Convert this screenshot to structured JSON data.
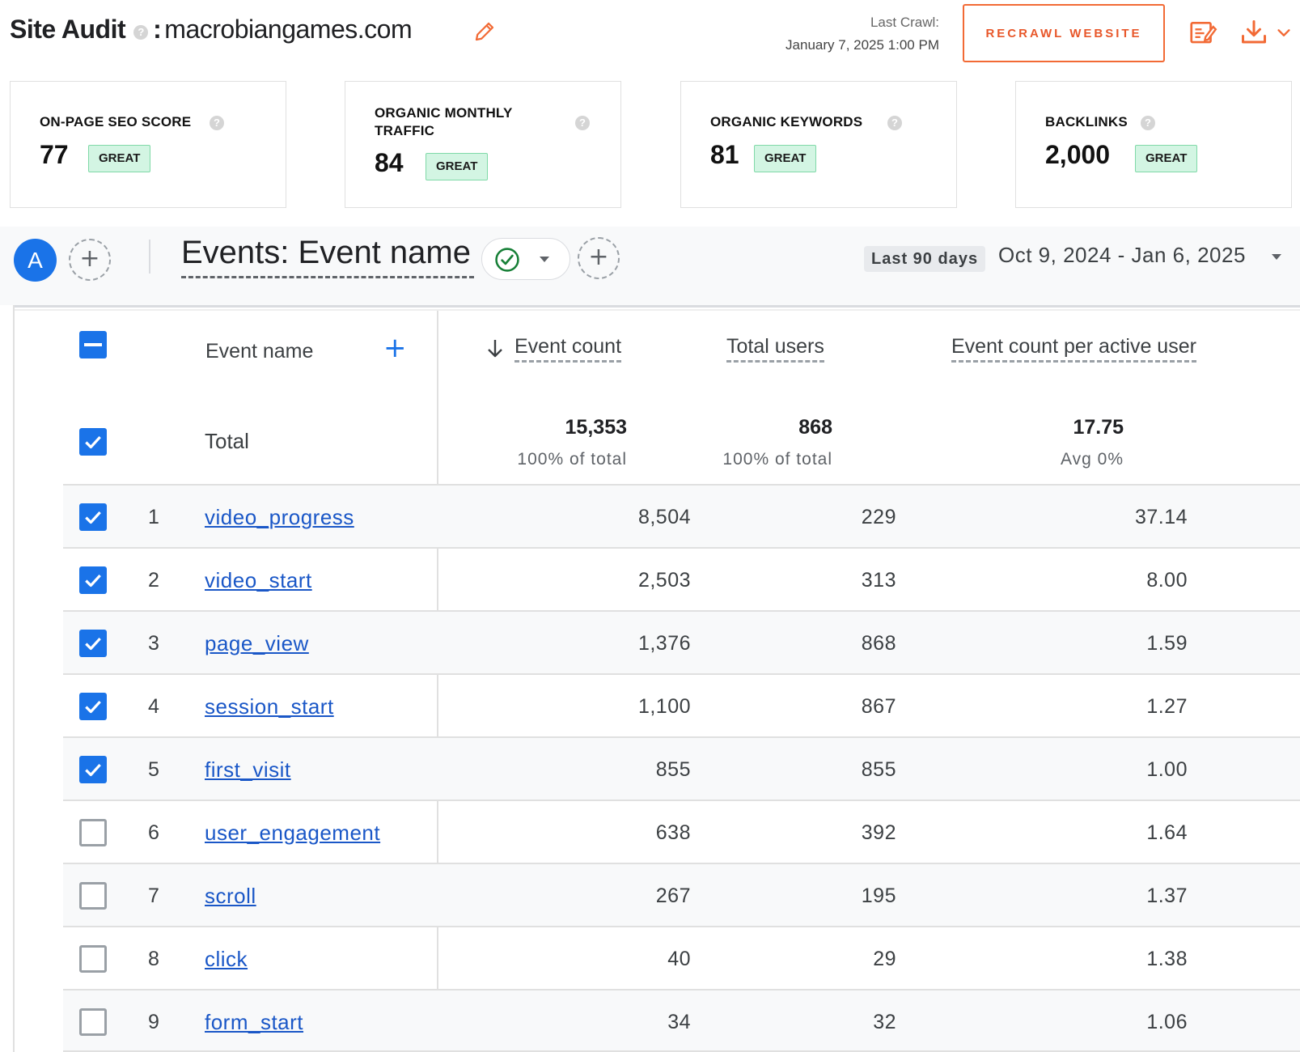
{
  "header": {
    "title_bold": "Site Audit",
    "help_glyph": "?",
    "separator": ":",
    "domain": "macrobiangames.com",
    "last_crawl_label": "Last Crawl:",
    "last_crawl_value": "January 7, 2025 1:00 PM",
    "recrawl_label": "RECRAWL WEBSITE",
    "icons": [
      "edit-pencil-icon",
      "report-edit-icon",
      "download-icon",
      "chevron-down-icon"
    ],
    "accent_color": "#f26a35"
  },
  "metrics": [
    {
      "title": "ON-PAGE SEO SCORE",
      "value": "77",
      "badge": "GREAT"
    },
    {
      "title": "ORGANIC MONTHLY TRAFFIC",
      "value": "84",
      "badge": "GREAT"
    },
    {
      "title": "ORGANIC KEYWORDS",
      "value": "81",
      "badge": "GREAT"
    },
    {
      "title": "BACKLINKS",
      "value": "2,000",
      "badge": "GREAT"
    }
  ],
  "toolbar": {
    "avatar_letter": "A",
    "report_title": "Events: Event name",
    "period_chip": "Last 90 days",
    "date_range": "Oct 9, 2024 - Jan 6, 2025",
    "icons": [
      "add-comparison-icon",
      "check-circle-icon",
      "caret-down-icon",
      "date-caret-icon"
    ]
  },
  "table": {
    "columns": [
      "Event name",
      "Event count",
      "Total users",
      "Event count per active user"
    ],
    "total": {
      "label": "Total",
      "event_count": "15,353",
      "event_count_sub": "100% of total",
      "total_users": "868",
      "total_users_sub": "100% of total",
      "per_user": "17.75",
      "per_user_sub": "Avg 0%"
    },
    "rows": [
      {
        "n": "1",
        "name": "video_progress",
        "count": "8,504",
        "users": "229",
        "per": "37.14",
        "checked": true
      },
      {
        "n": "2",
        "name": "video_start",
        "count": "2,503",
        "users": "313",
        "per": "8.00",
        "checked": true
      },
      {
        "n": "3",
        "name": "page_view",
        "count": "1,376",
        "users": "868",
        "per": "1.59",
        "checked": true
      },
      {
        "n": "4",
        "name": "session_start",
        "count": "1,100",
        "users": "867",
        "per": "1.27",
        "checked": true
      },
      {
        "n": "5",
        "name": "first_visit",
        "count": "855",
        "users": "855",
        "per": "1.00",
        "checked": true
      },
      {
        "n": "6",
        "name": "user_engagement",
        "count": "638",
        "users": "392",
        "per": "1.64",
        "checked": false
      },
      {
        "n": "7",
        "name": "scroll",
        "count": "267",
        "users": "195",
        "per": "1.37",
        "checked": false
      },
      {
        "n": "8",
        "name": "click",
        "count": "40",
        "users": "29",
        "per": "1.38",
        "checked": false
      },
      {
        "n": "9",
        "name": "form_start",
        "count": "34",
        "users": "32",
        "per": "1.06",
        "checked": false
      }
    ]
  }
}
